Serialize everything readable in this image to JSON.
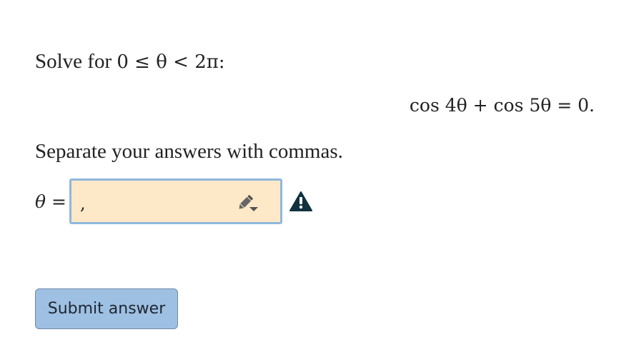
{
  "question": {
    "prompt_text": "Solve for",
    "condition": "0 ≤ θ < 2π:",
    "equation": "cos 4θ + cos 5θ = 0.",
    "instructions": "Separate your answers with commas."
  },
  "answer": {
    "variable": "θ",
    "equals": " =",
    "value": ",",
    "edit_icon": "pencil-edit-dropdown-icon",
    "warning_icon": "warning-triangle-icon",
    "input_background": "#fde9c8",
    "input_border": "#8fb8dd"
  },
  "submit": {
    "label": "Submit answer",
    "background": "#9dc0e3"
  }
}
